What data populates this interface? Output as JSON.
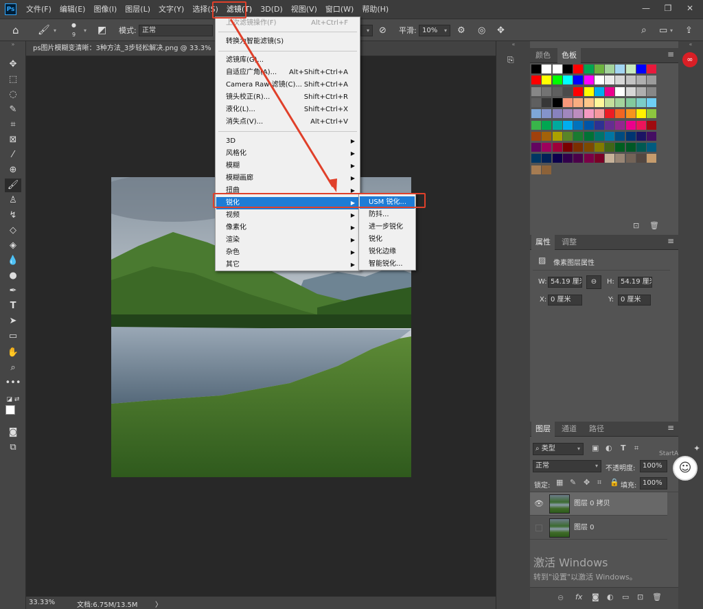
{
  "menubar": {
    "logo": "Ps",
    "items": [
      "文件(F)",
      "编辑(E)",
      "图像(I)",
      "图层(L)",
      "文字(Y)",
      "选择(S)",
      "滤镜(T)",
      "3D(D)",
      "视图(V)",
      "窗口(W)",
      "帮助(H)"
    ],
    "window_controls": [
      "—",
      "❐",
      "✕"
    ]
  },
  "options": {
    "brush_size": "9",
    "mode_label": "模式:",
    "mode_value": "正常",
    "smooth_label": "平滑:",
    "smooth_value": "10%"
  },
  "document": {
    "tab_title": "ps图片模糊变清晰：3种方法_3步轻松解决.png @ 33.3%",
    "zoom": "33.33%",
    "doc_size": "文档:6.75M/13.5M",
    "status_arrow": "〉"
  },
  "filter_menu": {
    "items": [
      {
        "label": "上次滤镜操作(F)",
        "shortcut": "Alt+Ctrl+F",
        "disabled": true
      },
      {
        "label": "转换为智能滤镜(S)",
        "shortcut": ""
      },
      {
        "label": "滤镜库(G)...",
        "shortcut": ""
      },
      {
        "label": "自适应广角(A)...",
        "shortcut": "Alt+Shift+Ctrl+A"
      },
      {
        "label": "Camera Raw 滤镜(C)...",
        "shortcut": "Shift+Ctrl+A"
      },
      {
        "label": "镜头校正(R)...",
        "shortcut": "Shift+Ctrl+R"
      },
      {
        "label": "液化(L)...",
        "shortcut": "Shift+Ctrl+X"
      },
      {
        "label": "消失点(V)...",
        "shortcut": "Alt+Ctrl+V"
      },
      {
        "label": "3D",
        "submenu": true
      },
      {
        "label": "风格化",
        "submenu": true
      },
      {
        "label": "模糊",
        "submenu": true
      },
      {
        "label": "模糊画廊",
        "submenu": true
      },
      {
        "label": "扭曲",
        "submenu": true
      },
      {
        "label": "锐化",
        "submenu": true,
        "highlighted": true
      },
      {
        "label": "视频",
        "submenu": true
      },
      {
        "label": "像素化",
        "submenu": true
      },
      {
        "label": "渲染",
        "submenu": true
      },
      {
        "label": "杂色",
        "submenu": true
      },
      {
        "label": "其它",
        "submenu": true
      }
    ]
  },
  "sharpen_submenu": {
    "items": [
      "USM 锐化...",
      "防抖...",
      "进一步锐化",
      "锐化",
      "锐化边缘",
      "智能锐化..."
    ],
    "highlighted_index": 0
  },
  "swatches_panel": {
    "tabs": [
      "颜色",
      "色板"
    ],
    "active_tab": "色板",
    "colors": [
      [
        "#000000",
        "#ffffff",
        "#ffffff",
        "#000000",
        "#ff0000",
        "#00a650",
        "#6db33f",
        "#a3d39c",
        "#a2d5f2",
        "#c7e9c0",
        "#0000ff",
        "#e8193c"
      ],
      [
        "#ff0000",
        "#ffff00",
        "#00ff00",
        "#00ffff",
        "#0000ff",
        "#ff00ff",
        "#ffffff",
        "#ebebeb",
        "#d7d7d7",
        "#c3c3c3",
        "#afafaf",
        "#9b9b9b"
      ],
      [
        "#878787",
        "#737373",
        "#5f5f5f",
        "#4b4b4b",
        "#ff0000",
        "#ffff00",
        "#00aeef",
        "#ec008c",
        "#ffffff",
        "#d7d7d7",
        "#afafaf",
        "#878787"
      ],
      [
        "#5f5f5f",
        "#373737",
        "#000000",
        "#f7977a",
        "#f9ad81",
        "#fdc68a",
        "#fff79a",
        "#c4df9b",
        "#a3d39c",
        "#82ca9d",
        "#7bcdc8",
        "#6ecff6"
      ],
      [
        "#7ea7d8",
        "#8493ca",
        "#8882be",
        "#a187be",
        "#bc8dbf",
        "#f49ac2",
        "#f6989d",
        "#ed1c24",
        "#f26522",
        "#f7941d",
        "#fff200",
        "#8dc63f"
      ],
      [
        "#39b54a",
        "#00a651",
        "#00a99d",
        "#00aeef",
        "#0072bc",
        "#0054a6",
        "#2e3192",
        "#662d91",
        "#92278f",
        "#ec008c",
        "#ed145b",
        "#9e0b0f"
      ],
      [
        "#a0410d",
        "#a36209",
        "#aba000",
        "#598527",
        "#1a7b30",
        "#007236",
        "#00746b",
        "#0076a3",
        "#004b80",
        "#003471",
        "#1b1464",
        "#440e62"
      ],
      [
        "#630460",
        "#9e005d",
        "#9e0039",
        "#790000",
        "#7b2e00",
        "#7d4900",
        "#827b00",
        "#406618",
        "#005e20",
        "#005826",
        "#005952",
        "#005b7f"
      ],
      [
        "#003663",
        "#002157",
        "#0d004c",
        "#32004b",
        "#4b0049",
        "#7b0046",
        "#7a0026",
        "#c7b299",
        "#998675",
        "#736357",
        "#534741",
        "#c69c6d"
      ],
      [
        "#a67c52",
        "#8c6239"
      ]
    ]
  },
  "properties_panel": {
    "tabs": [
      "属性",
      "调整"
    ],
    "title": "像素图层属性",
    "w_label": "W:",
    "w_value": "54.19 厘米",
    "h_label": "H:",
    "h_value": "54.19 厘米",
    "x_label": "X:",
    "x_value": "0 厘米",
    "y_label": "Y:",
    "y_value": "0 厘米"
  },
  "layers_panel": {
    "tabs": [
      "图层",
      "通道",
      "路径"
    ],
    "filter_kind": "类型",
    "blend_mode": "正常",
    "opacity_label": "不透明度:",
    "opacity_value": "100%",
    "lock_label": "锁定:",
    "fill_label": "填充:",
    "fill_value": "100%",
    "startai": "StartAI",
    "layers": [
      {
        "name": "图层 0 拷贝",
        "visible": true,
        "selected": true
      },
      {
        "name": "图层 0",
        "visible": false,
        "selected": false
      }
    ]
  },
  "watermark": {
    "line1": "激活 Windows",
    "line2": "转到\"设置\"以激活 Windows。"
  }
}
